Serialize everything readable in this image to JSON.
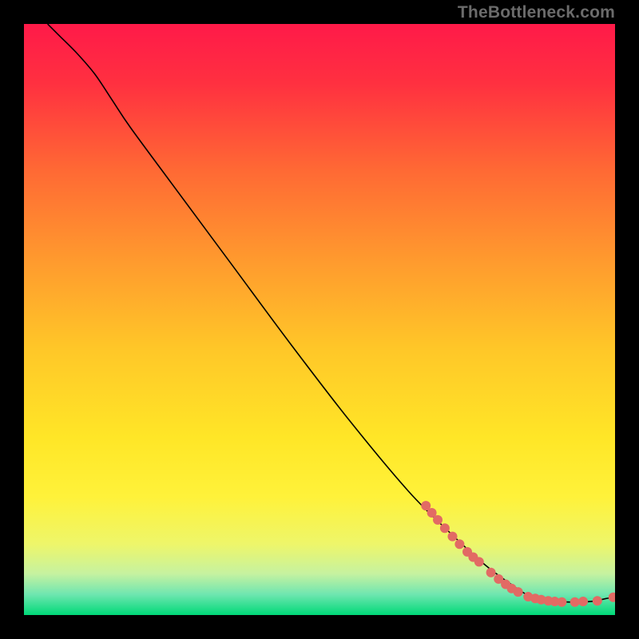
{
  "watermark": "TheBottleneck.com",
  "chart_data": {
    "type": "line",
    "title": "",
    "xlabel": "",
    "ylabel": "",
    "xlim": [
      0,
      100
    ],
    "ylim": [
      0,
      100
    ],
    "grid": false,
    "legend": false,
    "background_gradient": {
      "top_color": "#ff1a49",
      "mid_color": "#ffe627",
      "bottom_color": "#00d978",
      "stops": [
        {
          "offset": 0.0,
          "color": "#ff1a49"
        },
        {
          "offset": 0.1,
          "color": "#ff3040"
        },
        {
          "offset": 0.25,
          "color": "#ff6a34"
        },
        {
          "offset": 0.4,
          "color": "#ff9a2e"
        },
        {
          "offset": 0.55,
          "color": "#ffc728"
        },
        {
          "offset": 0.7,
          "color": "#ffe627"
        },
        {
          "offset": 0.8,
          "color": "#fff23a"
        },
        {
          "offset": 0.88,
          "color": "#eef66a"
        },
        {
          "offset": 0.93,
          "color": "#c6f2a0"
        },
        {
          "offset": 0.965,
          "color": "#6fe6b0"
        },
        {
          "offset": 1.0,
          "color": "#00d978"
        }
      ]
    },
    "series": [
      {
        "name": "curve",
        "style": "line",
        "color": "#000000",
        "width": 1.6,
        "points": [
          {
            "x": 4.0,
            "y": 100.0
          },
          {
            "x": 6.0,
            "y": 98.0
          },
          {
            "x": 9.0,
            "y": 95.0
          },
          {
            "x": 12.0,
            "y": 91.5
          },
          {
            "x": 15.0,
            "y": 87.0
          },
          {
            "x": 18.0,
            "y": 82.5
          },
          {
            "x": 25.0,
            "y": 73.0
          },
          {
            "x": 35.0,
            "y": 59.5
          },
          {
            "x": 45.0,
            "y": 46.0
          },
          {
            "x": 55.0,
            "y": 33.0
          },
          {
            "x": 65.0,
            "y": 21.0
          },
          {
            "x": 72.0,
            "y": 14.0
          },
          {
            "x": 78.0,
            "y": 8.5
          },
          {
            "x": 82.0,
            "y": 5.5
          },
          {
            "x": 85.0,
            "y": 3.5
          },
          {
            "x": 88.0,
            "y": 2.5
          },
          {
            "x": 92.0,
            "y": 2.2
          },
          {
            "x": 96.0,
            "y": 2.3
          },
          {
            "x": 98.5,
            "y": 2.8
          },
          {
            "x": 100.0,
            "y": 3.0
          }
        ]
      },
      {
        "name": "highlight-points",
        "style": "scatter",
        "color": "#e26a64",
        "radius": 6,
        "points": [
          {
            "x": 68.0,
            "y": 18.5
          },
          {
            "x": 69.0,
            "y": 17.3
          },
          {
            "x": 70.0,
            "y": 16.1
          },
          {
            "x": 71.2,
            "y": 14.7
          },
          {
            "x": 72.5,
            "y": 13.3
          },
          {
            "x": 73.7,
            "y": 12.0
          },
          {
            "x": 75.0,
            "y": 10.7
          },
          {
            "x": 76.0,
            "y": 9.8
          },
          {
            "x": 77.0,
            "y": 9.0
          },
          {
            "x": 79.0,
            "y": 7.2
          },
          {
            "x": 80.3,
            "y": 6.1
          },
          {
            "x": 81.5,
            "y": 5.2
          },
          {
            "x": 82.5,
            "y": 4.5
          },
          {
            "x": 83.6,
            "y": 3.9
          },
          {
            "x": 85.3,
            "y": 3.1
          },
          {
            "x": 86.5,
            "y": 2.8
          },
          {
            "x": 87.5,
            "y": 2.6
          },
          {
            "x": 88.7,
            "y": 2.4
          },
          {
            "x": 89.8,
            "y": 2.3
          },
          {
            "x": 91.0,
            "y": 2.2
          },
          {
            "x": 93.2,
            "y": 2.2
          },
          {
            "x": 94.6,
            "y": 2.3
          },
          {
            "x": 97.0,
            "y": 2.4
          },
          {
            "x": 99.7,
            "y": 3.0
          }
        ]
      }
    ]
  }
}
